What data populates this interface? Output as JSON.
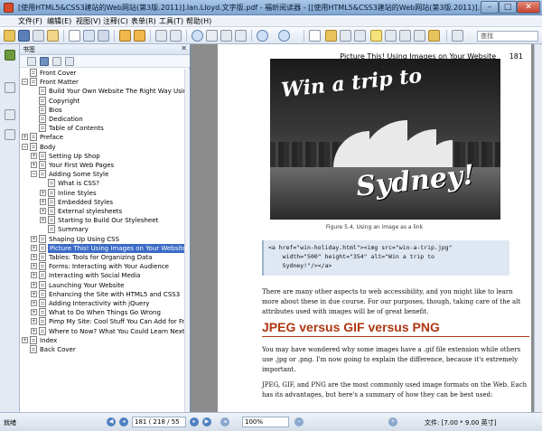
{
  "window": {
    "title": "[使用HTML5&CSS3建站的Web网站(第3版.2011)].Ian.Lloyd.文字版.pdf - 福昕阅读器 - [[使用HTML5&CSS3建站的Web网站(第3版.2011)].Ian.Lloyd.文字版]",
    "minimize": "–",
    "maximize": "□",
    "close": "✕"
  },
  "menubar": {
    "items": [
      "文件(F)",
      "编辑(E)",
      "视图(V)",
      "注释(C)",
      "表单(R)",
      "工具(T)",
      "帮助(H)"
    ]
  },
  "toolbar": {
    "zoom_search_placeholder": "查找"
  },
  "bookmarks_panel": {
    "title": "书签",
    "close": "✕",
    "items": [
      {
        "label": "Front Cover",
        "level": 0,
        "expander": "",
        "selected": false
      },
      {
        "label": "Front Matter",
        "level": 0,
        "expander": "−",
        "selected": false
      },
      {
        "label": "Build Your Own Website The Right Way Using",
        "level": 1,
        "expander": "",
        "selected": false
      },
      {
        "label": "Copyright",
        "level": 1,
        "expander": "",
        "selected": false
      },
      {
        "label": "Bios",
        "level": 1,
        "expander": "",
        "selected": false
      },
      {
        "label": "Dedication",
        "level": 1,
        "expander": "",
        "selected": false
      },
      {
        "label": "Table of Contents",
        "level": 1,
        "expander": "",
        "selected": false
      },
      {
        "label": "Preface",
        "level": 0,
        "expander": "+",
        "selected": false
      },
      {
        "label": "Body",
        "level": 0,
        "expander": "−",
        "selected": false
      },
      {
        "label": "Setting Up Shop",
        "level": 1,
        "expander": "+",
        "selected": false
      },
      {
        "label": "Your First Web Pages",
        "level": 1,
        "expander": "+",
        "selected": false
      },
      {
        "label": "Adding Some Style",
        "level": 1,
        "expander": "−",
        "selected": false
      },
      {
        "label": "What is CSS?",
        "level": 2,
        "expander": "",
        "selected": false
      },
      {
        "label": "Inline Styles",
        "level": 2,
        "expander": "+",
        "selected": false
      },
      {
        "label": "Embedded Styles",
        "level": 2,
        "expander": "+",
        "selected": false
      },
      {
        "label": "External stylesheets",
        "level": 2,
        "expander": "+",
        "selected": false
      },
      {
        "label": "Starting to Build Our Stylesheet",
        "level": 2,
        "expander": "+",
        "selected": false
      },
      {
        "label": "Summary",
        "level": 2,
        "expander": "",
        "selected": false
      },
      {
        "label": "Shaping Up Using CSS",
        "level": 1,
        "expander": "+",
        "selected": false
      },
      {
        "label": "Picture This! Using Images on Your Website",
        "level": 1,
        "expander": "+",
        "selected": true
      },
      {
        "label": "Tables: Tools for Organizing Data",
        "level": 1,
        "expander": "+",
        "selected": false
      },
      {
        "label": "Forms: Interacting with Your Audience",
        "level": 1,
        "expander": "+",
        "selected": false
      },
      {
        "label": "Interacting with Social Media",
        "level": 1,
        "expander": "+",
        "selected": false
      },
      {
        "label": "Launching Your Website",
        "level": 1,
        "expander": "+",
        "selected": false
      },
      {
        "label": "Enhancing the Site with HTML5 and CSS3",
        "level": 1,
        "expander": "+",
        "selected": false
      },
      {
        "label": "Adding Interactivity with jQuery",
        "level": 1,
        "expander": "+",
        "selected": false
      },
      {
        "label": "What to Do When Things Go Wrong",
        "level": 1,
        "expander": "+",
        "selected": false
      },
      {
        "label": "Pimp My Site: Cool Stuff You Can Add for Free",
        "level": 1,
        "expander": "+",
        "selected": false
      },
      {
        "label": "Where to Now? What You Could Learn Next",
        "level": 1,
        "expander": "+",
        "selected": false
      },
      {
        "label": "Index",
        "level": 0,
        "expander": "+",
        "selected": false
      },
      {
        "label": "Back Cover",
        "level": 0,
        "expander": "",
        "selected": false
      }
    ]
  },
  "document": {
    "running_head": "Picture This! Using Images on Your Website",
    "page_number": "181",
    "photo_text_1": "Win a trip to",
    "photo_text_2": "Sydney!",
    "caption": "Figure 5.4. Using an image as a link",
    "code_lines": [
      "<a href=\"win-holiday.html\"><img src=\"win-a-trip.jpg\"",
      "    width=\"500\" height=\"354\" alt=\"Win a trip to",
      "    Sydney!\"/></a>"
    ],
    "para1": "There are many other aspects to web accessibility, and you might like to learn more about these in due course. For our purposes, though, taking care of the alt attributes used with images will be of great benefit.",
    "heading": "JPEG versus GIF versus PNG",
    "para2": "You may have wondered why some images have a .gif file extension while others use .jpg or .png. I'm now going to explain the difference, because it's extremely important.",
    "para3": "JPEG, GIF, and PNG are the most commonly used image formats on the Web. Each has its advantages, but here's a summary of how they can be best used:"
  },
  "statusbar": {
    "status": "就绪",
    "page_field": "181 ( 218 / 55",
    "zoom": "100%",
    "doc_size": "文件: [7.00 * 9.00 英寸]"
  },
  "colors": {
    "heading": "#b03712",
    "selection": "#3a6bc7"
  }
}
